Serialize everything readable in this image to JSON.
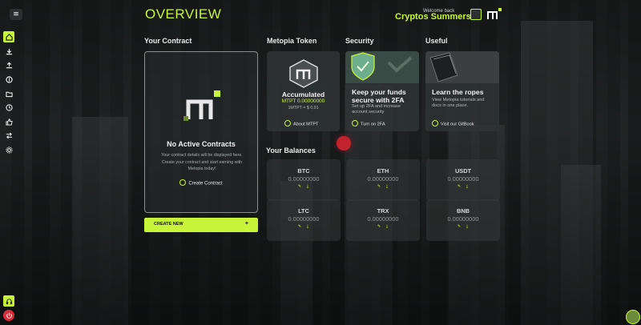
{
  "header": {
    "title": "OVERVIEW",
    "welcome": "Welcome back",
    "username": "Cryptos Summers"
  },
  "sidebar": {
    "items": [
      "home-icon",
      "download-icon",
      "upload-icon",
      "currency-icon",
      "folder-icon",
      "clock-icon",
      "thumbs-up-icon",
      "swap-icon",
      "gear-icon"
    ],
    "bottom": [
      "headset-icon",
      "power-icon"
    ]
  },
  "contract": {
    "heading": "Your Contract",
    "empty_title": "No Active Contracts",
    "empty_desc": "Your contract details will be displayed here. Create your contract and start earning with Metopia today!",
    "create_link": "Create Contract",
    "create_new_button": "CREATE NEW",
    "create_new_plus": "+"
  },
  "token": {
    "heading": "Metopia Token",
    "title": "Accumulated",
    "amount": "MTPT 0.00000000",
    "rate": "1MTPT = $ 0.01",
    "link": "About MTPT"
  },
  "security": {
    "heading": "Security",
    "title": "Keep your funds secure with 2FA",
    "desc": "Set up 2FA and increase account security",
    "link": "Turn on 2FA"
  },
  "useful": {
    "heading": "Useful",
    "title": "Learn the ropes",
    "desc": "View Metopia tutorials and docs in one place.",
    "link": "Visit our GitBook"
  },
  "balances": {
    "heading": "Your Balances",
    "items": [
      {
        "coin": "BTC",
        "amount": "0.00000000"
      },
      {
        "coin": "ETH",
        "amount": "0.00000000"
      },
      {
        "coin": "USDT",
        "amount": "0.00000000"
      },
      {
        "coin": "LTC",
        "amount": "0.00000000"
      },
      {
        "coin": "TRX",
        "amount": "0.00000000"
      },
      {
        "coin": "BNB",
        "amount": "0.00000000"
      }
    ]
  },
  "colors": {
    "accent": "#c8f53a",
    "danger": "#d72d3a"
  }
}
